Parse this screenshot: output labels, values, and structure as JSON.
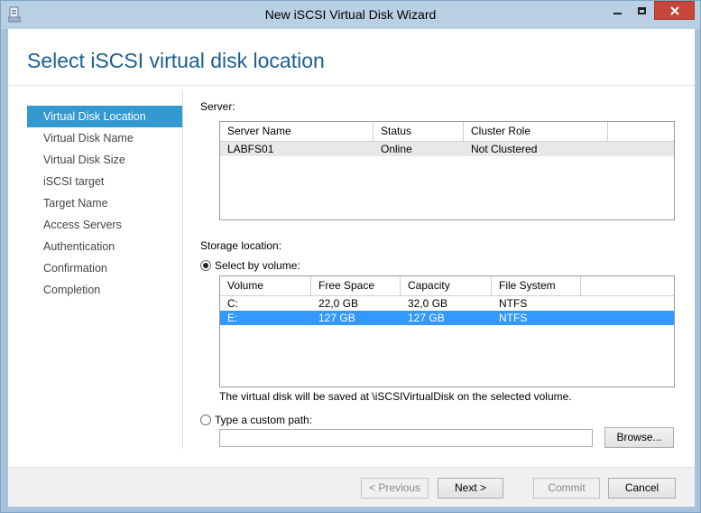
{
  "window": {
    "title": "New iSCSI Virtual Disk Wizard",
    "minimize_icon": "minimize-icon",
    "maximize_icon": "maximize-icon",
    "close_icon": "close-icon",
    "close_color": "#c7463a"
  },
  "page": {
    "title": "Select iSCSI virtual disk location",
    "title_color": "#1b5e92"
  },
  "nav": {
    "active_color": "#3399d0",
    "items": [
      {
        "label": "Virtual Disk Location",
        "active": true
      },
      {
        "label": "Virtual Disk Name",
        "active": false
      },
      {
        "label": "Virtual Disk Size",
        "active": false
      },
      {
        "label": "iSCSI target",
        "active": false
      },
      {
        "label": "Target Name",
        "active": false
      },
      {
        "label": "Access Servers",
        "active": false
      },
      {
        "label": "Authentication",
        "active": false
      },
      {
        "label": "Confirmation",
        "active": false
      },
      {
        "label": "Completion",
        "active": false
      }
    ]
  },
  "server": {
    "label": "Server:",
    "columns": [
      "Server Name",
      "Status",
      "Cluster Role"
    ],
    "rows": [
      [
        "LABFS01",
        "Online",
        "Not Clustered"
      ]
    ]
  },
  "storage": {
    "label": "Storage location:",
    "select_by_volume_label": "Select by volume:",
    "select_by_volume_checked": true,
    "columns": [
      "Volume",
      "Free Space",
      "Capacity",
      "File System"
    ],
    "rows": [
      [
        "C:",
        "22,0 GB",
        "32,0 GB",
        "NTFS"
      ],
      [
        "E:",
        "127 GB",
        "127 GB",
        "NTFS"
      ]
    ],
    "selected_row": 1,
    "selection_color": "#3399ff",
    "note": "The virtual disk will be saved at \\iSCSIVirtualDisk on the selected volume.",
    "custom_path_label": "Type a custom path:",
    "custom_path_checked": false,
    "custom_path_value": "",
    "browse_label": "Browse..."
  },
  "footer": {
    "previous_label": "< Previous",
    "next_label": "Next >",
    "commit_label": "Commit",
    "cancel_label": "Cancel"
  }
}
